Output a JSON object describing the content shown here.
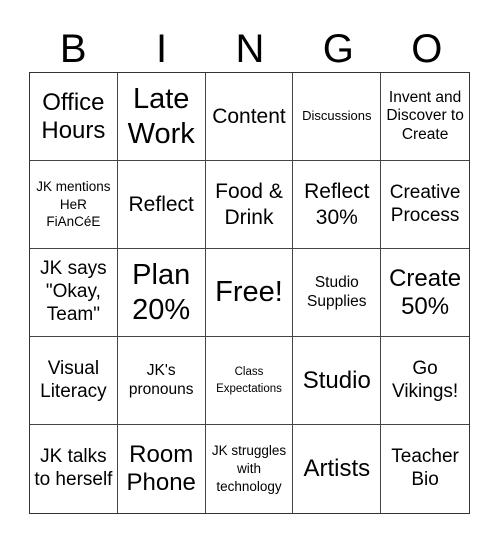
{
  "header": {
    "letters": [
      "B",
      "I",
      "N",
      "G",
      "O"
    ]
  },
  "cells": [
    {
      "text": "Office Hours"
    },
    {
      "text": "Late Work"
    },
    {
      "text": "Content"
    },
    {
      "text": "Discussions"
    },
    {
      "text": "Invent and Discover to Create"
    },
    {
      "text": "JK mentions HeR FiAnCéE"
    },
    {
      "text": "Reflect"
    },
    {
      "text": "Food & Drink"
    },
    {
      "text": "Reflect 30%"
    },
    {
      "text": "Creative Process"
    },
    {
      "text": "JK says \"Okay, Team\""
    },
    {
      "text": "Plan 20%"
    },
    {
      "text": "Free!"
    },
    {
      "text": "Studio Supplies"
    },
    {
      "text": "Create 50%"
    },
    {
      "text": "Visual Literacy"
    },
    {
      "text": "JK's pronouns"
    },
    {
      "text": "Class Expectations"
    },
    {
      "text": "Studio"
    },
    {
      "text": "Go Vikings!"
    },
    {
      "text": "JK talks to herself"
    },
    {
      "text": "Room Phone"
    },
    {
      "text": "JK struggles with technology"
    },
    {
      "text": "Artists"
    },
    {
      "text": "Teacher Bio"
    }
  ]
}
